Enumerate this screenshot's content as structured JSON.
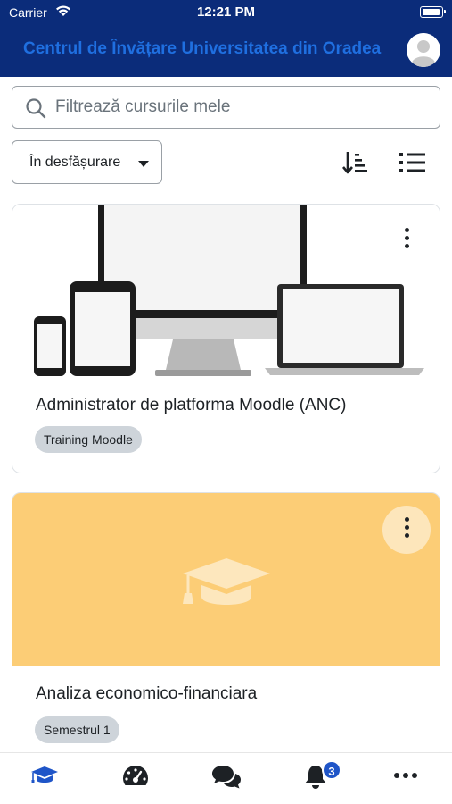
{
  "status_bar": {
    "carrier": "Carrier",
    "time": "12:21 PM"
  },
  "header": {
    "site_title": "Centrul de Învățare Universitatea din Oradea",
    "title_color": "#1f6fe0",
    "background_color": "#0b2c7a"
  },
  "search": {
    "placeholder": "Filtrează cursurile mele",
    "value": ""
  },
  "filter": {
    "selected": "În desfășurare"
  },
  "courses": [
    {
      "title": "Administrator de platforma Moodle (ANC)",
      "category": "Training Moodle",
      "image": "devices-illustration"
    },
    {
      "title": "Analiza economico-financiara",
      "category": "Semestrul 1",
      "image": "graduation-cap-placeholder",
      "image_color": "#fccd76"
    }
  ],
  "tabbar": {
    "items": [
      "home",
      "dashboard",
      "messages",
      "notifications",
      "more"
    ],
    "notifications_count": "3",
    "active_color": "#1f55c8"
  }
}
